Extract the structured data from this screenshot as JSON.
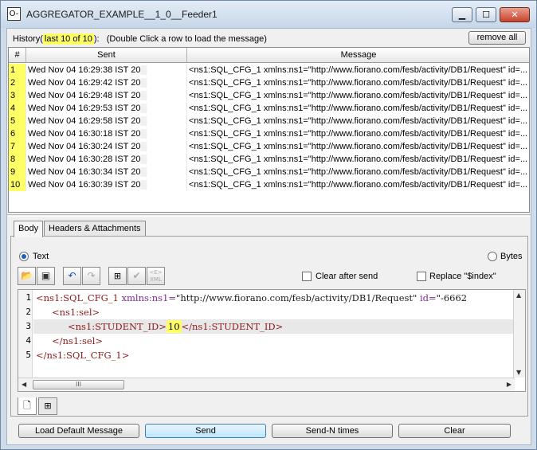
{
  "window": {
    "title": "AGGREGATOR_EXAMPLE__1_0__Feeder1",
    "icon_glyph": "O-",
    "controls": {
      "minimize": "▁",
      "maximize": "☐",
      "close": "✕"
    }
  },
  "history": {
    "prefix": "History(",
    "count": "last 10 of 10",
    "suffix": "):",
    "hint": "(Double Click a row to load the message)",
    "remove_all_label": "remove all"
  },
  "table": {
    "columns": [
      "#",
      "Sent",
      "Message"
    ],
    "rows": [
      {
        "num": "1",
        "sent": "Wed Nov 04 16:29:38 IST 20",
        "message": "<ns1:SQL_CFG_1 xmlns:ns1=\"http://www.fiorano.com/fesb/activity/DB1/Request\" id=..."
      },
      {
        "num": "2",
        "sent": "Wed Nov 04 16:29:42 IST 20",
        "message": "<ns1:SQL_CFG_1 xmlns:ns1=\"http://www.fiorano.com/fesb/activity/DB1/Request\" id=..."
      },
      {
        "num": "3",
        "sent": "Wed Nov 04 16:29:48 IST 20",
        "message": "<ns1:SQL_CFG_1 xmlns:ns1=\"http://www.fiorano.com/fesb/activity/DB1/Request\" id=..."
      },
      {
        "num": "4",
        "sent": "Wed Nov 04 16:29:53 IST 20",
        "message": "<ns1:SQL_CFG_1 xmlns:ns1=\"http://www.fiorano.com/fesb/activity/DB1/Request\" id=..."
      },
      {
        "num": "5",
        "sent": "Wed Nov 04 16:29:58 IST 20",
        "message": "<ns1:SQL_CFG_1 xmlns:ns1=\"http://www.fiorano.com/fesb/activity/DB1/Request\" id=..."
      },
      {
        "num": "6",
        "sent": "Wed Nov 04 16:30:18 IST 20",
        "message": "<ns1:SQL_CFG_1 xmlns:ns1=\"http://www.fiorano.com/fesb/activity/DB1/Request\" id=..."
      },
      {
        "num": "7",
        "sent": "Wed Nov 04 16:30:24 IST 20",
        "message": "<ns1:SQL_CFG_1 xmlns:ns1=\"http://www.fiorano.com/fesb/activity/DB1/Request\" id=..."
      },
      {
        "num": "8",
        "sent": "Wed Nov 04 16:30:28 IST 20",
        "message": "<ns1:SQL_CFG_1 xmlns:ns1=\"http://www.fiorano.com/fesb/activity/DB1/Request\" id=..."
      },
      {
        "num": "9",
        "sent": "Wed Nov 04 16:30:34 IST 20",
        "message": "<ns1:SQL_CFG_1 xmlns:ns1=\"http://www.fiorano.com/fesb/activity/DB1/Request\" id=..."
      },
      {
        "num": "10",
        "sent": "Wed Nov 04 16:30:39 IST 20",
        "message": "<ns1:SQL_CFG_1 xmlns:ns1=\"http://www.fiorano.com/fesb/activity/DB1/Request\" id=..."
      }
    ]
  },
  "tabs": {
    "body": "Body",
    "headers": "Headers & Attachments"
  },
  "format": {
    "text_label": "Text",
    "bytes_label": "Bytes",
    "selected": "Text"
  },
  "options": {
    "clear_after_send": "Clear after send",
    "replace_index": "Replace \"$index\""
  },
  "toolbar_icons": [
    "open-folder-icon",
    "save-icon",
    "undo-icon",
    "redo-icon",
    "xml-tree-icon",
    "validate-check-icon",
    "xml-format-icon"
  ],
  "editor": {
    "line_numbers": [
      "1",
      "2",
      "3",
      "4",
      "5"
    ],
    "line1": {
      "open": "<ns1:SQL_CFG_1",
      "attr": "xmlns:ns1=",
      "val": "\"http://www.fiorano.com/fesb/activity/DB1/Request\"",
      "attr2": "id=",
      "val2": "\"-6662"
    },
    "line2": "<ns1:sel>",
    "line3": {
      "open": "<ns1:STUDENT_ID>",
      "value": "10",
      "close": "</ns1:STUDENT_ID>"
    },
    "line4": "</ns1:sel>",
    "line5": "</ns1:SQL_CFG_1>",
    "hscroll_grip": "III"
  },
  "buttons": {
    "load_default": "Load Default Message",
    "send": "Send",
    "send_n": "Send-N times",
    "clear": "Clear"
  }
}
